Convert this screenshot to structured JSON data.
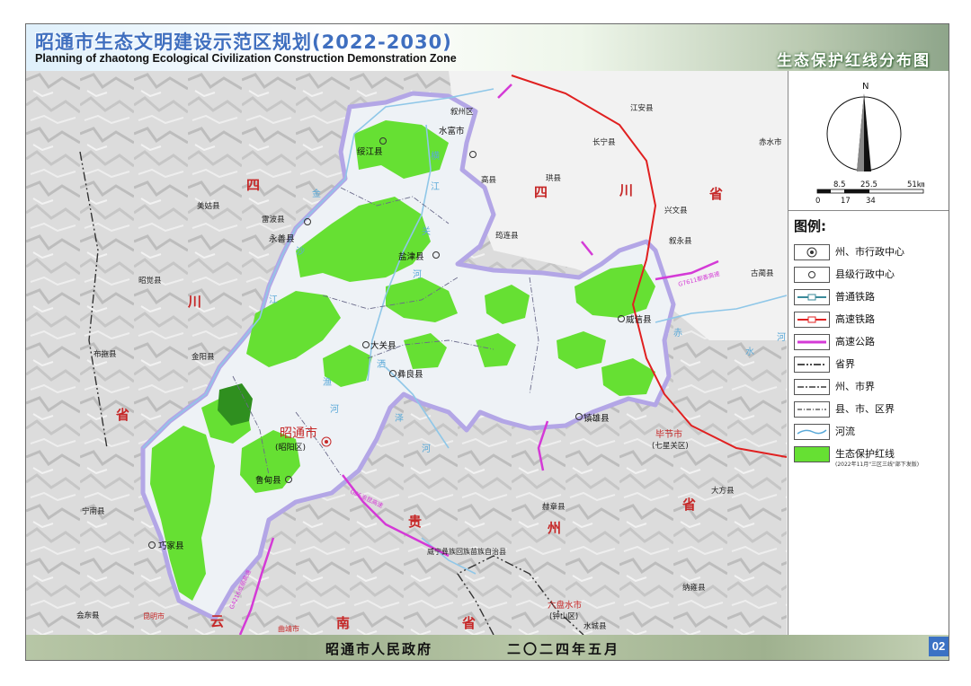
{
  "header": {
    "title_cn": "昭通市生态文明建设示范区规划(2022-2030)",
    "title_en": "Planning of zhaotong Ecological Civilization Construction Demonstration Zone",
    "sheet_title": "生态保护红线分布图"
  },
  "compass": {
    "north": "N",
    "scale_top": [
      "8.5",
      "25.5",
      "51㎞"
    ],
    "scale_bottom": [
      "0",
      "17",
      "34"
    ]
  },
  "legend": {
    "title": "图例:",
    "items": [
      {
        "label": "州、市行政中心",
        "symbol": "prefecture-center"
      },
      {
        "label": "县级行政中心",
        "symbol": "county-center"
      },
      {
        "label": "普通铁路",
        "symbol": "railway"
      },
      {
        "label": "高速铁路",
        "symbol": "high-speed-railway"
      },
      {
        "label": "高速公路",
        "symbol": "expressway"
      },
      {
        "label": "省界",
        "symbol": "province-boundary"
      },
      {
        "label": "州、市界",
        "symbol": "prefecture-boundary"
      },
      {
        "label": "县、市、区界",
        "symbol": "county-boundary"
      },
      {
        "label": "河流",
        "symbol": "river"
      },
      {
        "label": "生态保护红线",
        "symbol": "ecological-redline",
        "note": "(2022年11月\"三区三线\"部下发版)"
      }
    ]
  },
  "map": {
    "city_main": "昭通市",
    "city_main_sub": "(昭阳区)",
    "counties": [
      "绥江县",
      "水富市",
      "盐津县",
      "永善县",
      "大关县",
      "彝良县",
      "威信县",
      "镇雄县",
      "鲁甸县",
      "巧家县"
    ],
    "outside_places": [
      "叙州区",
      "江安县",
      "长宁县",
      "高县",
      "珙县",
      "兴文县",
      "筠连县",
      "叙永县",
      "古蔺县",
      "赤水市",
      "美姑县",
      "雷波县",
      "昭觉县",
      "布拖县",
      "金阳县",
      "宁南县",
      "会东县",
      "威宁彝族回族苗族自治县",
      "赫章县",
      "纳雍县",
      "大方县",
      "水城县",
      "钟山区"
    ],
    "bijie": "毕节市",
    "bijie_sub": "(七星关区)",
    "liupanshui": "六盘水市",
    "liupanshui_sub": "(钟山区)",
    "province_chars": [
      "四",
      "川",
      "省",
      "贵",
      "州",
      "省",
      "云",
      "南",
      "省",
      "四",
      "川",
      "省"
    ],
    "river_chars": [
      "金",
      "沙",
      "江",
      "横",
      "江",
      "关",
      "河",
      "洒",
      "渔",
      "河",
      "泽",
      "河",
      "赤",
      "水",
      "河"
    ],
    "road_labels": [
      "G85渝昆高速",
      "G7611都香高速",
      "G4216成丽高速"
    ],
    "stat_cities": [
      "昆明市",
      "曲靖市"
    ]
  },
  "footer": {
    "government": "昭通市人民政府",
    "date": "二〇二四年五月",
    "page": "02"
  },
  "colors": {
    "redline_green": "#66e033",
    "study_area": "#eef2f6",
    "boundary_purple": "#b3a6e6",
    "title_blue": "#3f6fbf"
  }
}
